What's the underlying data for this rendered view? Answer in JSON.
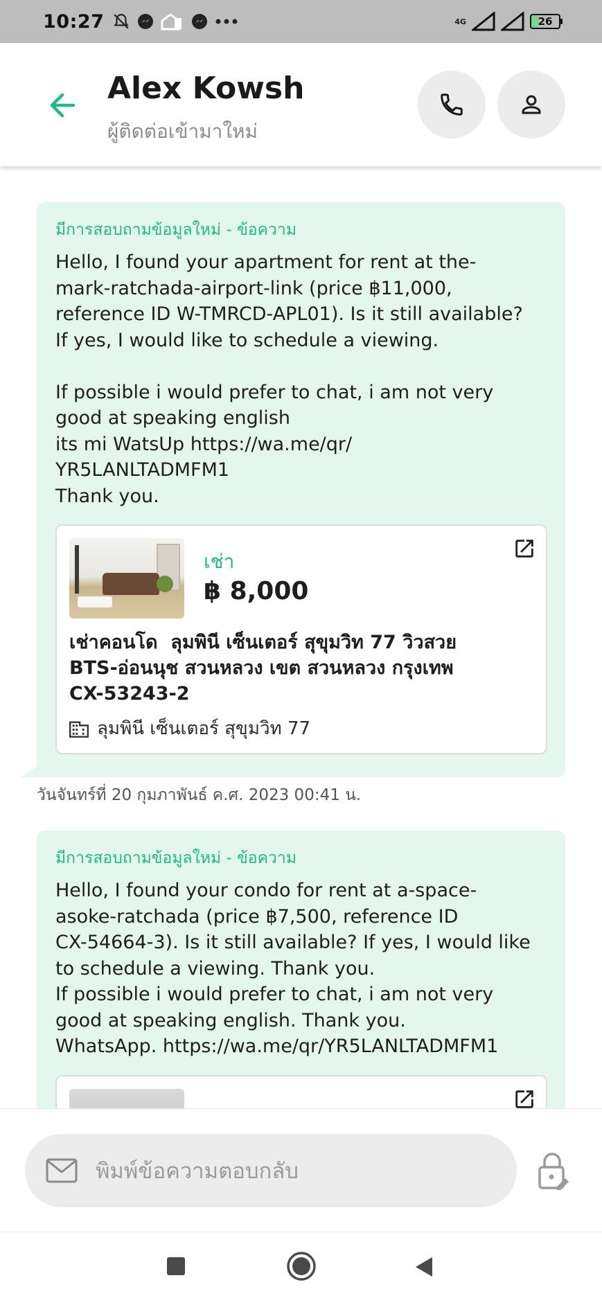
{
  "status_bar": {
    "time": "10:27",
    "network": "4G",
    "battery": "26"
  },
  "header": {
    "contact_name": "Alex Kowsh",
    "contact_subtitle": "ผู้ติดต่อเข้ามาใหม่"
  },
  "messages": [
    {
      "label": "มีการสอบถามข้อมูลใหม่ - ข้อความ",
      "text": "Hello, I found your apartment for rent at the-\nmark-ratchada-airport-link (price ฿11,000,\nreference ID W-TMRCD-APL01). Is it still available?\nIf yes, I would like to schedule a viewing.\n\nIf possible i would prefer to chat, i am not very\ngood at speaking english\nits mi WatsUp https://wa.me/qr/\nYR5LANLTADMFM1\nThank you.",
      "card": {
        "type": "เช่า",
        "price": "฿ 8,000",
        "title": "เช่าคอนโด  ลุมพินี เซ็นเตอร์ สุขุมวิท 77 วิวสวย\nBTS-อ่อนนุช สวนหลวง เขต สวนหลวง กรุงเทพ\nCX-53243-2",
        "building": "ลุมพินี เซ็นเตอร์ สุขุมวิท 77"
      },
      "timestamp": "วันจันทร์ที่ 20 กุมภาพันธ์ ค.ศ. 2023 00:41 น."
    },
    {
      "label": "มีการสอบถามข้อมูลใหม่ - ข้อความ",
      "text": "Hello, I found your condo for rent at a-space-\nasoke-ratchada (price ฿7,500, reference ID\nCX-54664-3). Is it still available? If yes, I would like\nto schedule a viewing. Thank you.\nIf possible i would prefer to chat, i am not very\ngood at speaking english. Thank you.\nWhatsApp. https://wa.me/qr/YR5LANLTADMFM1"
    }
  ],
  "composer": {
    "placeholder": "พิมพ์ข้อความตอบกลับ"
  },
  "colors": {
    "accent": "#1ebc83",
    "bubble": "#e3f7ee"
  }
}
